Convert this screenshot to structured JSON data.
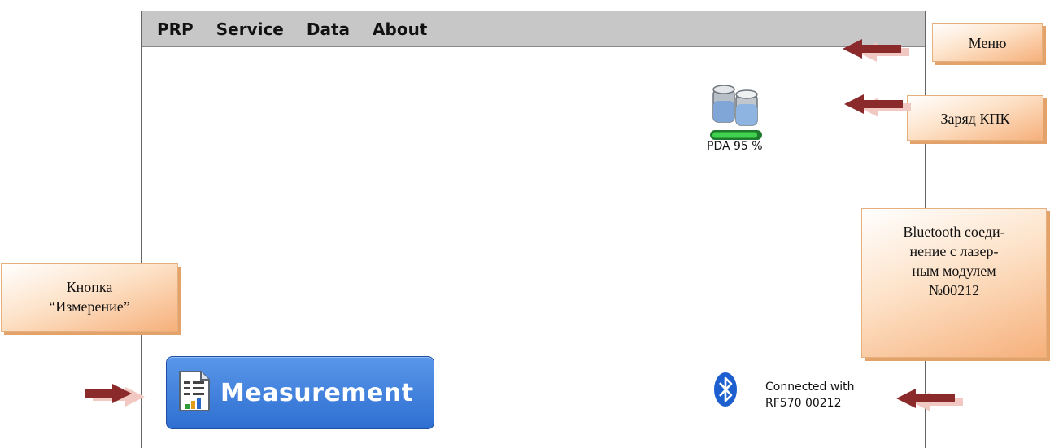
{
  "menu": {
    "items": [
      {
        "label": "PRP"
      },
      {
        "label": "Service"
      },
      {
        "label": "Data"
      },
      {
        "label": "About"
      }
    ]
  },
  "status": {
    "battery_label": "PDA 95 %",
    "battery_level_percent": 95,
    "bluetooth_line1": "Connected with",
    "bluetooth_line2": "RF570 00212"
  },
  "measurement_button": {
    "label": "Measurement"
  },
  "annotations": {
    "menu": "Меню",
    "charge": "Заряд КПК",
    "bluetooth": [
      "Bluetooth соеди-",
      "нение с лазер-",
      "ным модулем",
      "№00212"
    ],
    "button": [
      "Кнопка",
      "“Измерение”"
    ]
  },
  "colors": {
    "menubar": "#c7c7c7",
    "button": "#3a7ddc",
    "arrow": "#8b2a2a",
    "callout": "#f6b07b"
  }
}
